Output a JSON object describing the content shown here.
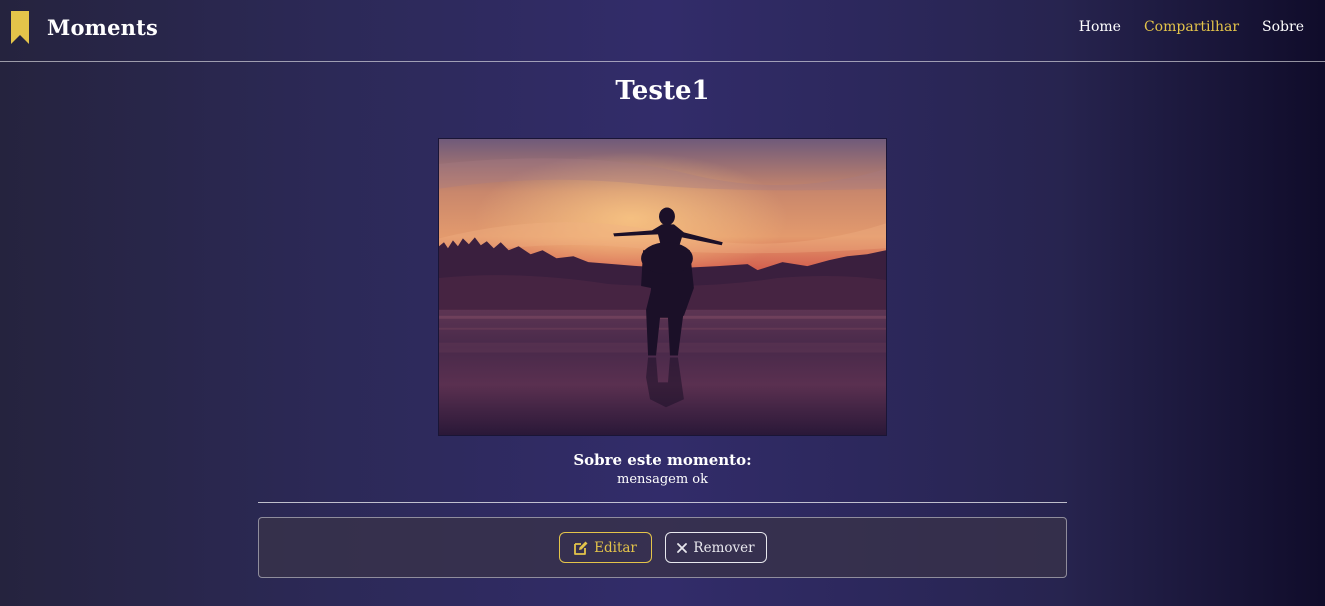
{
  "header": {
    "brand": "Moments",
    "brand_icon": "bookmark-icon",
    "nav": [
      "Home",
      "Compartilhar",
      "Sobre"
    ],
    "active_nav": "Compartilhar",
    "accent_color": "#e4c44a"
  },
  "moment": {
    "title": "Teste1",
    "image_description_icon": "sunset-silhouette-photo",
    "about_heading": "Sobre este momento:",
    "about_text": "mensagem ok"
  },
  "actions": {
    "edit_label": "Editar",
    "edit_icon": "edit-icon",
    "remove_label": "Remover",
    "remove_icon": "close-icon"
  }
}
